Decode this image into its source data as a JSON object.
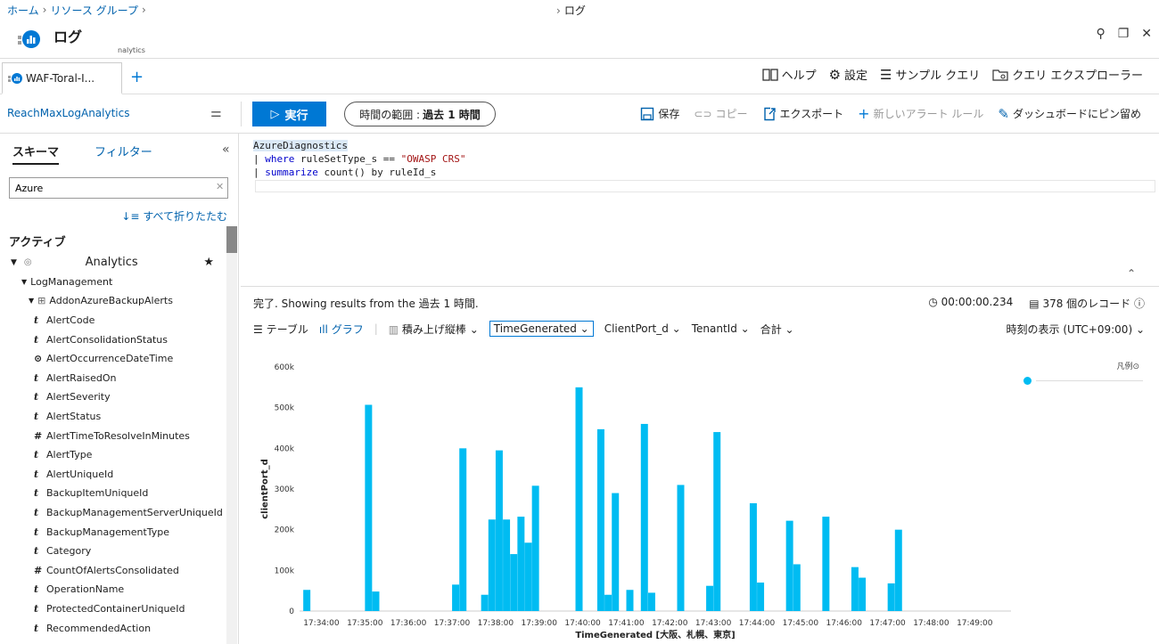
{
  "breadcrumb": {
    "home": "ホーム",
    "resource_group": "リソース グループ",
    "current": "ログ"
  },
  "title": {
    "text": "ログ",
    "subtitle": "nalytics"
  },
  "window": {
    "pin": "⚲",
    "restore": "❐",
    "close": "✕"
  },
  "tab": {
    "label": "WAF-Toral-I...",
    "add": "+"
  },
  "top_actions": {
    "help": "ヘルプ",
    "settings": "設定",
    "samples": "サンプル クエリ",
    "explorer": "クエリ エクスプローラー"
  },
  "toolbar": {
    "workspace": "ReachMaxLogAnalytics",
    "run": "実行",
    "time_range_label": "時間の範囲 :",
    "time_range_value": "過去 1 時間",
    "save": "保存",
    "copy": "コピー",
    "export": "エクスポート",
    "new_alert": "新しいアラート ルール",
    "pin": "ダッシュボードにピン留め"
  },
  "left": {
    "tab_schema": "スキーマ",
    "tab_filter": "フィルター",
    "search_value": "Azure",
    "collapse_all": "すべて折りたたむ",
    "active_heading": "アクティブ",
    "workspace_node": "Analytics",
    "group_node": "LogManagement",
    "table_node": "AddonAzureBackupAlerts",
    "columns": [
      {
        "type": "t",
        "name": "AlertCode"
      },
      {
        "type": "t",
        "name": "AlertConsolidationStatus"
      },
      {
        "type": "clock",
        "name": "AlertOccurrenceDateTime"
      },
      {
        "type": "t",
        "name": "AlertRaisedOn"
      },
      {
        "type": "t",
        "name": "AlertSeverity"
      },
      {
        "type": "t",
        "name": "AlertStatus"
      },
      {
        "type": "#",
        "name": "AlertTimeToResolveInMinutes"
      },
      {
        "type": "t",
        "name": "AlertType"
      },
      {
        "type": "t",
        "name": "AlertUniqueId"
      },
      {
        "type": "t",
        "name": "BackupItemUniqueId"
      },
      {
        "type": "t",
        "name": "BackupManagementServerUniqueId"
      },
      {
        "type": "t",
        "name": "BackupManagementType"
      },
      {
        "type": "t",
        "name": "Category"
      },
      {
        "type": "#",
        "name": "CountOfAlertsConsolidated"
      },
      {
        "type": "t",
        "name": "OperationName"
      },
      {
        "type": "t",
        "name": "ProtectedContainerUniqueId"
      },
      {
        "type": "t",
        "name": "RecommendedAction"
      }
    ]
  },
  "query": {
    "line1": "AzureDiagnostics",
    "line2_pre": "| ",
    "line2_kw": "where",
    "line2_mid": " ruleSetType_s == ",
    "line2_str": "\"OWASP CRS\"",
    "line3_pre": "| ",
    "line3_kw": "summarize",
    "line3_rest": " count() by ruleId_s"
  },
  "results": {
    "status": "完了. Showing results from the 過去 1 時間.",
    "duration": "00:00:00.234",
    "records": "378 個のレコード"
  },
  "viewbar": {
    "table": "テーブル",
    "chart": "グラフ",
    "chart_type": "積み上げ縦棒",
    "x_col": "TimeGenerated",
    "y_col": "ClientPort_d",
    "split": "TenantId",
    "agg": "合計",
    "timezone": "時刻の表示 (UTC+09:00)"
  },
  "legend": {
    "label": "凡例"
  },
  "chart_data": {
    "type": "bar",
    "xlabel": "TimeGenerated [大阪、札幌、東京]",
    "ylabel": "clientPort_d",
    "ylim": [
      0,
      600000
    ],
    "yticks": [
      "0",
      "100k",
      "200k",
      "300k",
      "400k",
      "500k",
      "600k"
    ],
    "xticks": [
      "17:34:00",
      "17:35:00",
      "17:36:00",
      "17:37:00",
      "17:38:00",
      "17:39:00",
      "17:40:00",
      "17:41:00",
      "17:42:00",
      "17:43:00",
      "17:44:00",
      "17:45:00",
      "17:46:00",
      "17:47:00",
      "17:48:00",
      "17:49:00"
    ],
    "color": "#00bcf2",
    "bars": [
      {
        "t": "17:33:40",
        "v": 52000
      },
      {
        "t": "17:35:05",
        "v": 507000
      },
      {
        "t": "17:35:15",
        "v": 48000
      },
      {
        "t": "17:37:05",
        "v": 65000
      },
      {
        "t": "17:37:15",
        "v": 400000
      },
      {
        "t": "17:37:45",
        "v": 40000
      },
      {
        "t": "17:37:55",
        "v": 225000
      },
      {
        "t": "17:38:05",
        "v": 395000
      },
      {
        "t": "17:38:15",
        "v": 225000
      },
      {
        "t": "17:38:25",
        "v": 140000
      },
      {
        "t": "17:38:35",
        "v": 232000
      },
      {
        "t": "17:38:45",
        "v": 168000
      },
      {
        "t": "17:38:55",
        "v": 308000
      },
      {
        "t": "17:39:55",
        "v": 550000
      },
      {
        "t": "17:40:25",
        "v": 447000
      },
      {
        "t": "17:40:35",
        "v": 40000
      },
      {
        "t": "17:40:45",
        "v": 290000
      },
      {
        "t": "17:41:05",
        "v": 52000
      },
      {
        "t": "17:41:25",
        "v": 460000
      },
      {
        "t": "17:41:35",
        "v": 45000
      },
      {
        "t": "17:42:15",
        "v": 310000
      },
      {
        "t": "17:42:55",
        "v": 62000
      },
      {
        "t": "17:43:05",
        "v": 440000
      },
      {
        "t": "17:43:55",
        "v": 265000
      },
      {
        "t": "17:44:05",
        "v": 70000
      },
      {
        "t": "17:44:45",
        "v": 222000
      },
      {
        "t": "17:44:55",
        "v": 115000
      },
      {
        "t": "17:45:35",
        "v": 232000
      },
      {
        "t": "17:46:15",
        "v": 108000
      },
      {
        "t": "17:46:25",
        "v": 82000
      },
      {
        "t": "17:47:05",
        "v": 68000
      },
      {
        "t": "17:47:15",
        "v": 200000
      }
    ]
  }
}
